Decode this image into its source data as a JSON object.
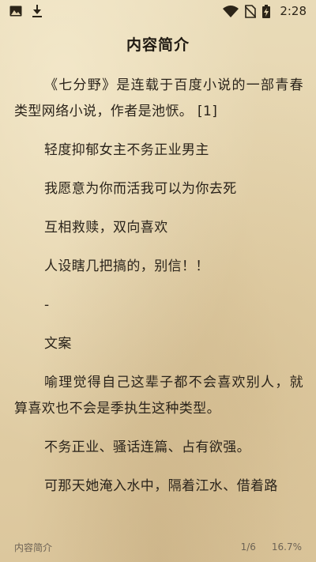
{
  "status_bar": {
    "time": "2:28",
    "icons": [
      "image-icon",
      "download-icon",
      "wifi-icon",
      "no-sim-icon",
      "battery-charging-icon"
    ]
  },
  "header": {
    "title": "内容简介"
  },
  "paragraphs": [
    "《七分野》是连载于百度小说的一部青春类型网络小说，作者是池恹。 [1]",
    "轻度抑郁女主不务正业男主",
    "我愿意为你而活我可以为你去死",
    "互相救赎，双向喜欢",
    "人设瞎几把搞的，别信！！",
    "-",
    "文案",
    "喻理觉得自己这辈子都不会喜欢别人，就算喜欢也不会是季执生这种类型。",
    "不务正业、骚话连篇、占有欲强。",
    "可那天她淹入水中，隔着江水、借着路"
  ],
  "footer": {
    "chapter": "内容简介",
    "page": "1/6",
    "progress": "16.7%"
  },
  "colors": {
    "paper": "#e6d6b1",
    "text": "#2a231a",
    "footer_text": "#6d6355"
  }
}
